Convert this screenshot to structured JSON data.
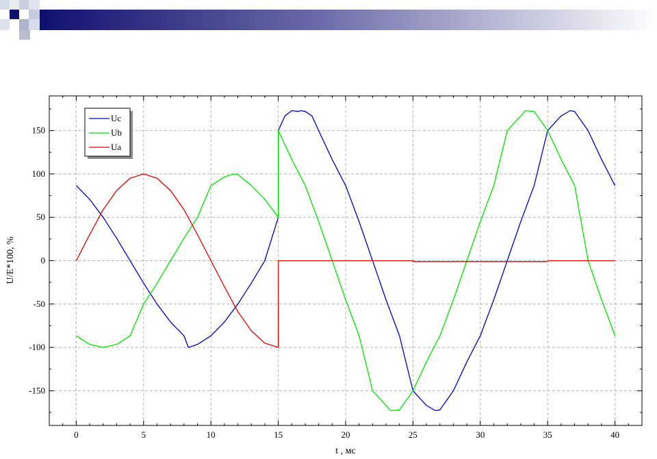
{
  "chart_data": {
    "type": "line",
    "title": "",
    "xlabel": "t , мс",
    "ylabel": "U/E*100, %",
    "xlim": [
      -2,
      42
    ],
    "ylim": [
      -190,
      190
    ],
    "xticks": [
      0,
      5,
      10,
      15,
      20,
      25,
      30,
      35,
      40
    ],
    "yticks": [
      -150,
      -100,
      -50,
      0,
      50,
      100,
      150
    ],
    "grid": true,
    "legend_position": "top-left",
    "series": [
      {
        "name": "Uc",
        "color": "#0000c8",
        "x": [
          0,
          1,
          2,
          3,
          4,
          5,
          6,
          7,
          8,
          8.33,
          9,
          10,
          11,
          12,
          13,
          14,
          15,
          15,
          15.5,
          16,
          16.5,
          16.67,
          17,
          17.5,
          18,
          19,
          20,
          21,
          22,
          23,
          24,
          25,
          26,
          26.67,
          27,
          28,
          29,
          30,
          31,
          32,
          33,
          34,
          35,
          36,
          36.67,
          37,
          38,
          39,
          40
        ],
        "y": [
          86.6,
          70.7,
          50,
          25.9,
          0,
          -25.9,
          -50,
          -70.7,
          -86.6,
          -100,
          -96.6,
          -86.6,
          -70.7,
          -50,
          -25.9,
          0,
          50,
          150,
          166.9,
          173,
          172.1,
          173,
          172.1,
          166.9,
          150,
          116.8,
          86.6,
          45,
          0,
          -45,
          -86.6,
          -150,
          -166.9,
          -173,
          -172.1,
          -150,
          -116.8,
          -86.6,
          -45,
          0,
          45,
          86.6,
          150,
          166.9,
          173,
          172.1,
          150,
          116.8,
          86.6
        ]
      },
      {
        "name": "Ub",
        "color": "#00e600",
        "x": [
          0,
          1,
          2,
          3,
          4,
          5,
          6,
          7,
          8,
          9,
          10,
          11,
          11.67,
          12,
          13,
          14,
          15,
          15,
          16,
          17,
          18,
          19,
          20,
          21,
          22,
          23,
          23.33,
          24,
          25,
          26,
          27,
          28,
          29,
          30,
          31,
          32,
          33,
          33.33,
          34,
          35,
          36,
          37,
          38,
          39,
          40
        ],
        "y": [
          -86.6,
          -96.6,
          -100,
          -96.6,
          -86.6,
          -50,
          -25.9,
          0,
          25.9,
          50,
          86.6,
          96.6,
          100,
          99.5,
          86.6,
          70.7,
          50,
          150,
          116.8,
          86.6,
          45,
          0,
          -45,
          -86.6,
          -150,
          -166.9,
          -173,
          -172.1,
          -150,
          -116.8,
          -86.6,
          -45,
          0,
          45,
          86.6,
          150,
          166.9,
          173,
          172.1,
          150,
          116.8,
          86.6,
          0,
          -45,
          -86.6
        ]
      },
      {
        "name": "Ua",
        "color": "#e60000",
        "x": [
          0,
          1,
          2,
          3,
          4,
          5,
          6,
          7,
          8,
          9,
          10,
          11,
          12,
          13,
          14,
          15,
          15,
          15.01,
          20,
          25,
          25.01,
          30,
          35,
          35.01,
          40
        ],
        "y": [
          0,
          30,
          58.8,
          80.9,
          95.1,
          100,
          95.1,
          80.9,
          58.8,
          30,
          0,
          -30,
          -58.8,
          -80.9,
          -95.1,
          -100,
          -100,
          0,
          0,
          0,
          -1,
          -1,
          -1,
          0,
          0
        ]
      }
    ]
  }
}
